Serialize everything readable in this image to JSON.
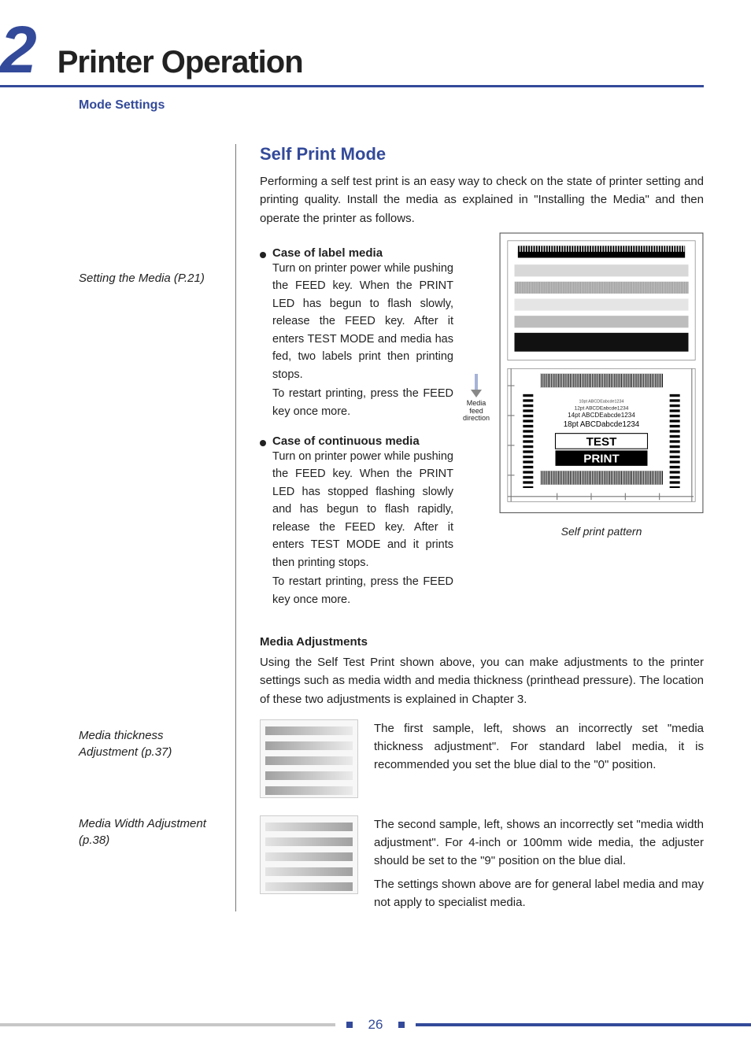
{
  "chapter": {
    "number": "2",
    "title": "Printer Operation"
  },
  "subhead": "Mode Settings",
  "margin": {
    "note1": "Setting the Media (P.21)",
    "note2": "Media thickness Adjustment (p.37)",
    "note3": "Media Width Adjustment (p.38)"
  },
  "self_print": {
    "heading": "Self Print Mode",
    "intro": "Performing a self test print is an easy way to check on the state of printer setting and printing quality.  Install the media as explained in \"Installing the Media\" and then operate the printer as follows.",
    "case_label_title": "Case of label media",
    "case_label_body1": "Turn on printer power while pushing the FEED key. When the PRINT LED has begun to flash slowly, release the FEED key. After it enters TEST MODE and media has fed, two labels print then printing stops.",
    "case_label_body2": "To restart printing, press the FEED key once more.",
    "case_cont_title": "Case of continuous media",
    "case_cont_body1": "Turn on printer power while pushing the FEED key. When the PRINT LED has stopped flashing slowly and has begun to flash rapidly, release the FEED key. After it enters TEST MODE and it prints then printing stops.",
    "case_cont_body2": "To restart printing, press the FEED key once more.",
    "media_feed_label": "Media feed direction",
    "caption": "Self print pattern",
    "pattern": {
      "lines": [
        "10pt ABCDEabcde1234",
        "12pt ABCDEabcde1234",
        "14pt ABCDEabcde1234",
        "18pt ABCDabcde1234"
      ],
      "test": "TEST",
      "print": "PRINT"
    }
  },
  "media_adj": {
    "heading": "Media Adjustments",
    "intro": "Using the Self Test Print shown above, you can make adjustments to the printer settings such as media width and media thickness (printhead pressure). The location of these two adjustments is explained in Chapter 3.",
    "sample1": "The first sample, left, shows an incorrectly set \"media thickness adjustment\".  For standard label media, it is recommended you set the blue dial to the \"0\" position.",
    "sample2": "The second sample, left, shows an incorrectly set \"media width adjustment\".  For 4-inch or 100mm wide media, the adjuster should be set to the \"9\" position on the blue dial.",
    "closing": "The settings shown above are for general label media and may not apply to specialist media."
  },
  "page_number": "26"
}
